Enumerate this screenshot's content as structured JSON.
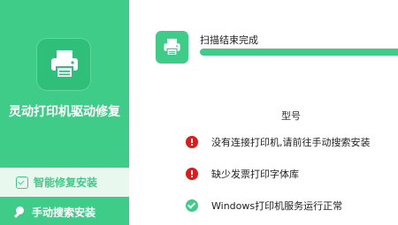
{
  "app": {
    "title": "灵动打印机驱动修复",
    "icon": "printer-icon"
  },
  "nav": {
    "smart_repair": {
      "label": "智能修复安装",
      "icon": "download-check-icon"
    },
    "manual_search": {
      "label": "手动搜索安装",
      "icon": "search-icon"
    }
  },
  "scan": {
    "status": "扫描结束完成",
    "icon": "printer-icon",
    "progress": 1.0
  },
  "model": {
    "label": "型号"
  },
  "results": [
    {
      "status": "error",
      "icon": "error-icon",
      "text": "没有连接打印机,请前往手动搜索安装"
    },
    {
      "status": "error",
      "icon": "error-icon",
      "text": "缺少发票打印字体库"
    },
    {
      "status": "ok",
      "icon": "check-icon",
      "text": "Windows打印机服务运行正常"
    }
  ],
  "colors": {
    "accent": "#3fcc88",
    "error": "#e01a1a"
  }
}
